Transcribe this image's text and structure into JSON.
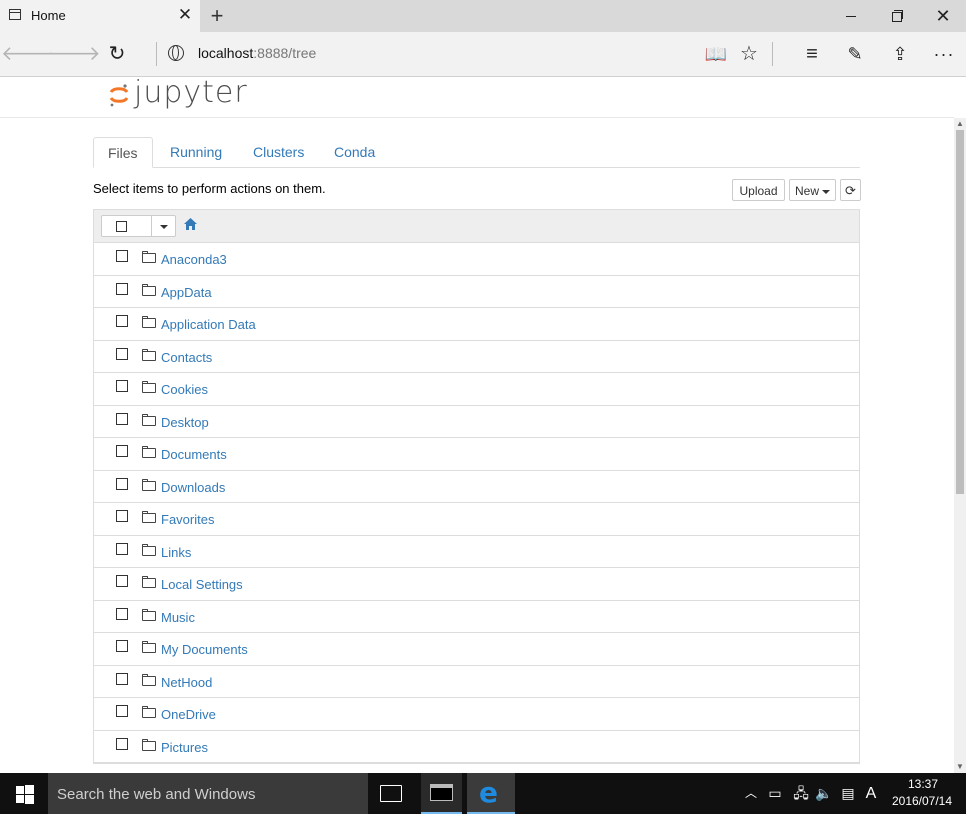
{
  "browser": {
    "tab_title": "Home",
    "tab_close": "✕",
    "new_tab": "+",
    "address_host": "localhost",
    "address_rest": ":8888/tree",
    "icons": [
      "back-arrow-icon",
      "forward-arrow-icon",
      "refresh-icon",
      "globe-icon",
      "reading-view-icon",
      "favorite-star-icon",
      "hub-icon",
      "web-note-icon",
      "share-icon",
      "more-icon"
    ]
  },
  "jupyter": {
    "logo_text": "jupyter",
    "logo_color": "#f37726",
    "tabs": [
      {
        "label": "Files",
        "active": true
      },
      {
        "label": "Running",
        "active": false
      },
      {
        "label": "Clusters",
        "active": false
      },
      {
        "label": "Conda",
        "active": false
      }
    ],
    "select_hint": "Select items to perform actions on them.",
    "upload_label": "Upload",
    "new_label": "New",
    "link_color": "#337ab7",
    "items": [
      "Anaconda3",
      "AppData",
      "Application Data",
      "Contacts",
      "Cookies",
      "Desktop",
      "Documents",
      "Downloads",
      "Favorites",
      "Links",
      "Local Settings",
      "Music",
      "My Documents",
      "NetHood",
      "OneDrive",
      "Pictures"
    ]
  },
  "taskbar": {
    "search_placeholder": "Search the web and Windows",
    "lang": "A",
    "time": "13:37",
    "date": "2016/07/14",
    "apps": [
      "command-prompt",
      "microsoft-edge"
    ]
  }
}
